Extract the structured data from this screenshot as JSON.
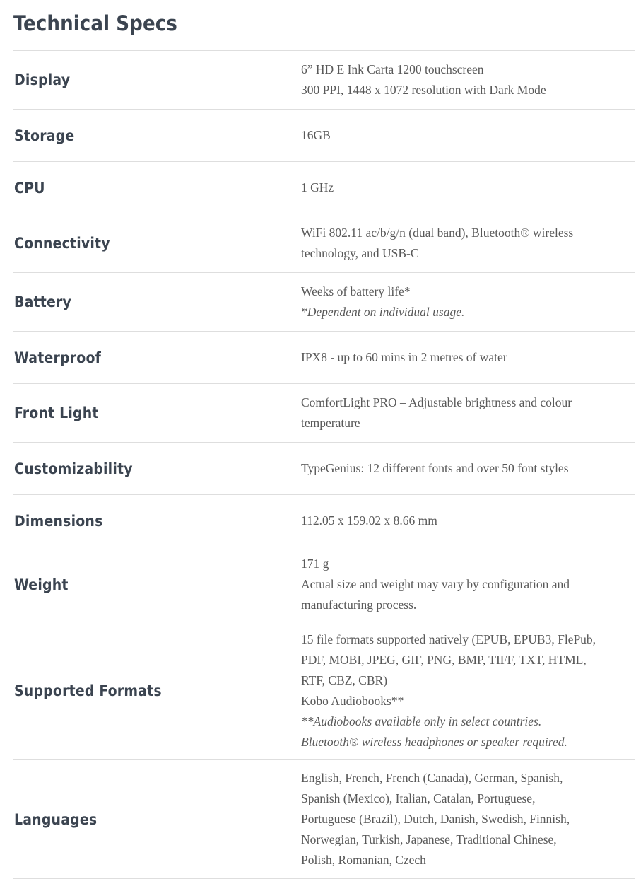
{
  "page": {
    "title": "Technical Specs",
    "title_color": "#3b4450",
    "divider_color": "#dedede",
    "value_text_color": "#595959",
    "background": "#ffffff"
  },
  "specs": [
    {
      "id": "display",
      "label": "Display",
      "lines": [
        {
          "text": "6” HD E Ink Carta 1200 touchscreen",
          "italic": false
        },
        {
          "text": "300 PPI, 1448 x 1072 resolution with Dark Mode",
          "italic": false
        }
      ]
    },
    {
      "id": "storage",
      "label": "Storage",
      "lines": [
        {
          "text": "16GB",
          "italic": false
        }
      ]
    },
    {
      "id": "cpu",
      "label": "CPU",
      "lines": [
        {
          "text": "1 GHz",
          "italic": false
        }
      ]
    },
    {
      "id": "connectivity",
      "label": "Connectivity",
      "lines": [
        {
          "text": "WiFi 802.11 ac/b/g/n (dual band), Bluetooth® wireless",
          "italic": false
        },
        {
          "text": "technology, and USB-C",
          "italic": false
        }
      ]
    },
    {
      "id": "battery",
      "label": "Battery",
      "lines": [
        {
          "text": "Weeks of battery life*",
          "italic": false
        },
        {
          "text": "*Dependent on individual usage.",
          "italic": true
        }
      ]
    },
    {
      "id": "waterproof",
      "label": "Waterproof",
      "lines": [
        {
          "text": "IPX8 - up to 60 mins in 2 metres of water",
          "italic": false
        }
      ]
    },
    {
      "id": "front-light",
      "label": "Front Light",
      "lines": [
        {
          "text": "ComfortLight PRO – Adjustable brightness and colour",
          "italic": false
        },
        {
          "text": "temperature",
          "italic": false
        }
      ]
    },
    {
      "id": "customizability",
      "label": "Customizability",
      "lines": [
        {
          "text": "TypeGenius: 12 different fonts and over 50 font styles",
          "italic": false
        }
      ]
    },
    {
      "id": "dimensions",
      "label": "Dimensions",
      "lines": [
        {
          "text": "112.05 x 159.02 x 8.66 mm",
          "italic": false
        }
      ]
    },
    {
      "id": "weight",
      "label": "Weight",
      "lines": [
        {
          "text": "171 g",
          "italic": false
        },
        {
          "text": "Actual size and weight may vary by configuration and",
          "italic": false
        },
        {
          "text": "manufacturing process.",
          "italic": false
        }
      ]
    },
    {
      "id": "supported-formats",
      "label": "Supported Formats",
      "lines": [
        {
          "text": "15 file formats supported natively (EPUB, EPUB3, FlePub,",
          "italic": false
        },
        {
          "text": "PDF, MOBI, JPEG, GIF, PNG, BMP, TIFF, TXT, HTML,",
          "italic": false
        },
        {
          "text": "RTF, CBZ, CBR)",
          "italic": false
        },
        {
          "text": "Kobo Audiobooks**",
          "italic": false
        },
        {
          "text": "**Audiobooks available only in select countries.",
          "italic": true
        },
        {
          "text": "Bluetooth® wireless headphones or speaker required.",
          "italic": true
        }
      ]
    },
    {
      "id": "languages",
      "label": "Languages",
      "lines": [
        {
          "text": "English, French, French (Canada), German, Spanish,",
          "italic": false
        },
        {
          "text": "Spanish (Mexico), Italian, Catalan, Portuguese,",
          "italic": false
        },
        {
          "text": "Portuguese (Brazil), Dutch, Danish, Swedish, Finnish,",
          "italic": false
        },
        {
          "text": "Norwegian, Turkish, Japanese, Traditional Chinese,",
          "italic": false
        },
        {
          "text": "Polish, Romanian, Czech",
          "italic": false
        }
      ]
    }
  ]
}
